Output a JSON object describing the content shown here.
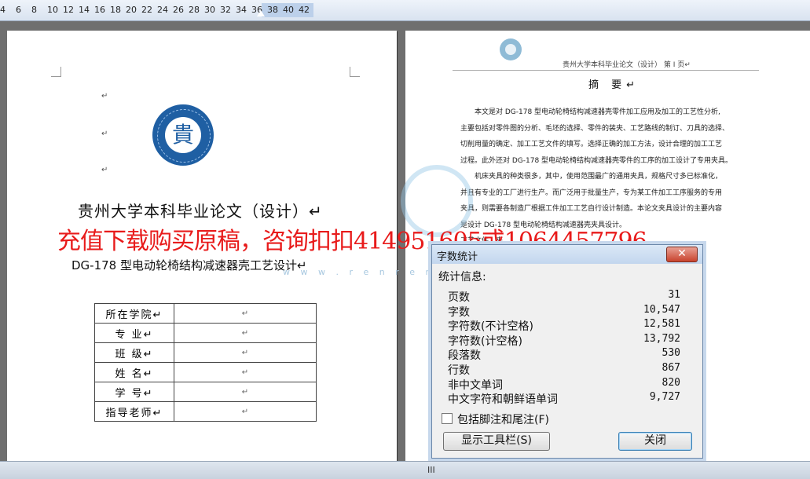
{
  "ruler": {
    "numbers": [
      "4",
      "6",
      "8",
      "10",
      "12",
      "14",
      "16",
      "18",
      "20",
      "22",
      "24",
      "26",
      "28",
      "30",
      "32",
      "34",
      "36",
      "38",
      "40",
      "42"
    ]
  },
  "page1": {
    "para_marks": [
      "↵",
      "↵",
      "↵"
    ],
    "title": "贵州大学本科毕业论文（设计）↵",
    "subtitle": "DG-178 型电动轮椅结构减速器壳工艺设计↵",
    "logo_glyph": "貴",
    "rows": [
      {
        "label": "所在学院↵",
        "value": "↵"
      },
      {
        "label": "专    业↵",
        "value": "↵"
      },
      {
        "label": "班    级↵",
        "value": "↵"
      },
      {
        "label": "姓    名↵",
        "value": "↵"
      },
      {
        "label": "学    号↵",
        "value": "↵"
      },
      {
        "label": "指导老师↵",
        "value": "↵"
      }
    ]
  },
  "page2": {
    "header": "贵州大学本科毕业论文（设计）                第 I 页↵",
    "abstract_title": "摘  要↵",
    "lines": [
      "　　本文是对 DG-178 型电动轮椅结构减速器壳零件加工应用及加工的工艺性分析,",
      "主要包括对零件图的分析、毛坯的选择、零件的装夹、工艺路线的制订、刀具的选择、",
      "切削用量的确定、加工工艺文件的填写。选择正确的加工方法，设计合理的加工工艺",
      "过程。此外还对 DG-178 型电动轮椅结构减速器壳零件的工序的加工设计了专用夹具。",
      "　　机床夹具的种类很多，其中，使用范围最广的通用夹具，规格尺寸多已标准化，",
      "并且有专业的工厂进行生产。而广泛用于批量生产，专为某工件加工工序服务的专用",
      "夹具，则需要各制造厂根据工件加工工艺自行设计制造。本论文夹具设计的主要内容",
      "是设计 DG-178 型电动轮椅结构减速器壳夹具设计。",
      "                                                              工艺文件，夹"
    ]
  },
  "watermark": {
    "text": "充值下载购买原稿，咨询扣扣414951605或1064457796",
    "url": "w w w . r e n r e n d o c . c o m"
  },
  "dialog": {
    "title": "字数统计",
    "close_glyph": "✕",
    "heading": "统计信息:",
    "stats": [
      {
        "label": "页数",
        "value": "31"
      },
      {
        "label": "字数",
        "value": "10,547"
      },
      {
        "label": "字符数(不计空格)",
        "value": "12,581"
      },
      {
        "label": "字符数(计空格)",
        "value": "13,792"
      },
      {
        "label": "段落数",
        "value": "530"
      },
      {
        "label": "行数",
        "value": "867"
      },
      {
        "label": "非中文单词",
        "value": "820"
      },
      {
        "label": "中文字符和朝鲜语单词",
        "value": "9,727"
      }
    ],
    "checkbox_label": "包括脚注和尾注(F)",
    "toolbar_button": "显示工具栏(S)",
    "close_button": "关闭"
  },
  "statusbar": {
    "grip": "III"
  }
}
